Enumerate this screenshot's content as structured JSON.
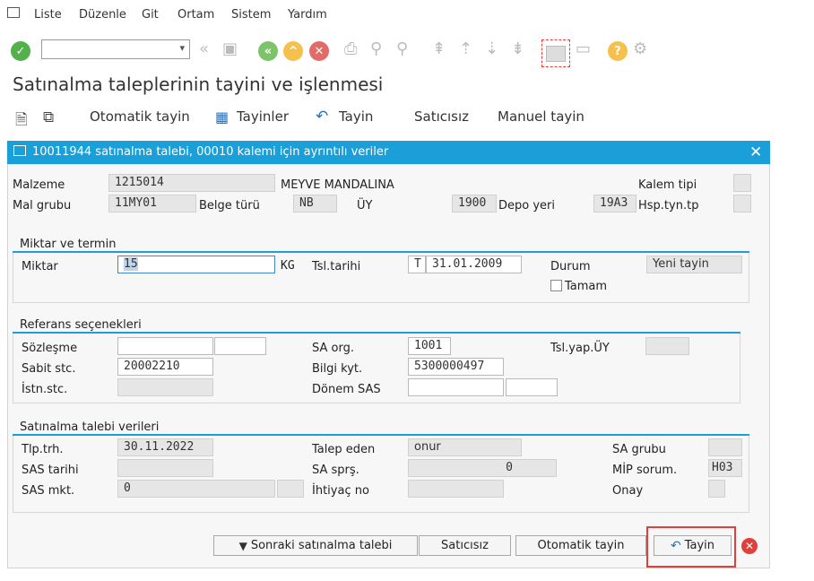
{
  "menu": {
    "items": [
      "Liste",
      "Düzenle",
      "Git",
      "Ortam",
      "Sistem",
      "Yardım"
    ]
  },
  "page_title": "Satınalma taleplerinin tayini ve işlenmesi",
  "appbar": {
    "otomatik": "Otomatik tayin",
    "tayinler": "Tayinler",
    "tayin": "Tayin",
    "saticisiz": "Satıcısız",
    "manuel": "Manuel tayin"
  },
  "dialog": {
    "title": "10011944 satınalma talebi, 00010 kalemi için ayrıntılı veriler",
    "header": {
      "malzeme_label": "Malzeme",
      "malzeme": "1215014",
      "malzeme_desc": "MEYVE MANDALINA",
      "kalem_tipi_label": "Kalem tipi",
      "mal_grubu_label": "Mal grubu",
      "mal_grubu": "11MY01",
      "belge_turu_label": "Belge türü",
      "belge_turu": "NB",
      "uy_label": "ÜY",
      "uy": "1900",
      "depo_label": "Depo yeri",
      "depo": "19A3",
      "hsp_label": "Hsp.tyn.tp"
    },
    "miktar_group": {
      "title": "Miktar ve termin",
      "miktar_label": "Miktar",
      "miktar": "15",
      "unit": "KG",
      "tsl_tarihi_label": "Tsl.tarihi",
      "tsl_type": "T",
      "tsl_tarihi": "31.01.2009",
      "durum_label": "Durum",
      "durum": "Yeni tayin",
      "tamam_label": "Tamam"
    },
    "referans_group": {
      "title": "Referans seçenekleri",
      "sozlesme_label": "Sözleşme",
      "sozlesme": "",
      "sozlesme_kalem": "",
      "sabit_label": "Sabit stc.",
      "sabit": "20002210",
      "istn_label": "İstn.stc.",
      "sa_org_label": "SA org.",
      "sa_org": "1001",
      "bilgi_label": "Bilgi kyt.",
      "bilgi": "5300000497",
      "donem_label": "Dönem SAS",
      "donem": "",
      "donem2": "",
      "tsl_yap_label": "Tsl.yap.ÜY"
    },
    "talep_group": {
      "title": "Satınalma talebi verileri",
      "tlp_trh_label": "Tlp.trh.",
      "tlp_trh": "30.11.2022",
      "sas_tarihi_label": "SAS tarihi",
      "sas_mkt_label": "SAS mkt.",
      "sas_mkt": "0",
      "talep_eden_label": "Talep eden",
      "talep_eden": "onur",
      "sa_sprs_label": "SA sprş.",
      "sa_sprs": "0",
      "ihtiyac_label": "İhtiyaç no",
      "sa_grubu_label": "SA grubu",
      "mip_label": "MİP sorum.",
      "mip": "H03",
      "onay_label": "Onay"
    },
    "buttons": {
      "sonraki": "Sonraki satınalma talebi",
      "saticisiz": "Satıcısız",
      "otomatik": "Otomatik tayin",
      "tayin": "Tayin"
    }
  }
}
